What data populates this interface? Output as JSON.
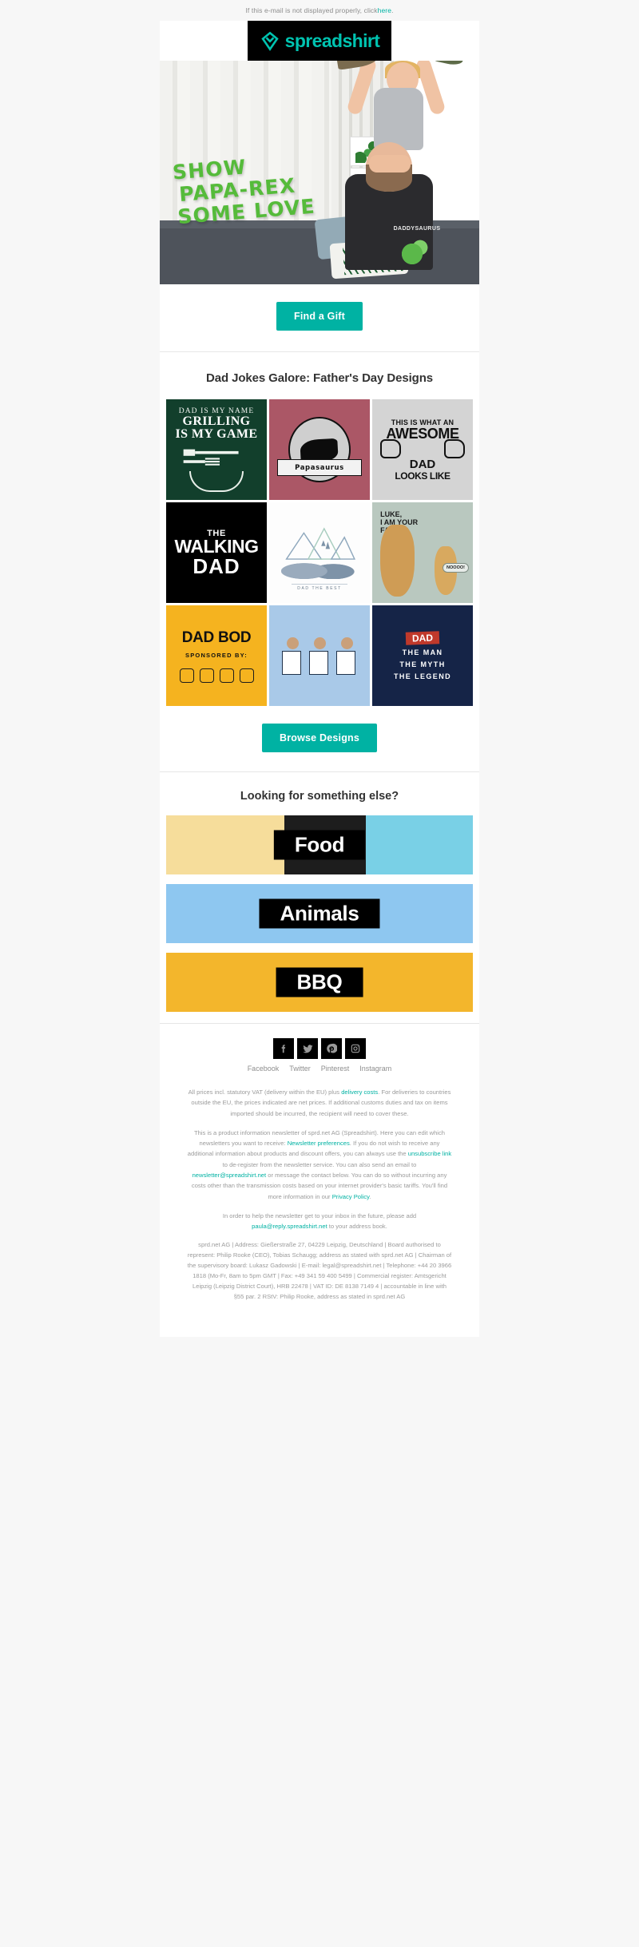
{
  "preheader": {
    "text_before": "If this e-mail is not displayed properly, click ",
    "link": "here",
    "text_after": "."
  },
  "brand": {
    "name": "spreadshirt",
    "logo_icon": "spreadshirt-heart-logo",
    "accent_color": "#00b2a3",
    "logo_bg": "#000000"
  },
  "hero": {
    "headline_line1": "SHOW",
    "headline_line2": "PAPA-REX",
    "headline_line3": "SOME LOVE",
    "headline_color": "#55bb3a",
    "shirt_text": "DADDYSAURUS",
    "alt": "Father holding son on shoulders with toy dinosaurs"
  },
  "cta": {
    "find_gift_label": "Find a Gift",
    "browse_label": "Browse Designs"
  },
  "designs_section": {
    "heading": "Dad Jokes Galore: Father's Day Designs",
    "tiles": [
      {
        "name": "grilling",
        "line1": "DAD IS MY NAME",
        "line2": "GRILLING",
        "line3": "IS MY GAME",
        "bg": "#123f2c"
      },
      {
        "name": "papasaurus",
        "label": "Papasaurus",
        "bg": "#ab5766"
      },
      {
        "name": "awesome-dad",
        "line1": "THIS IS WHAT AN",
        "line2": "AWESOME",
        "line3": "DAD",
        "line4": "LOOKS LIKE",
        "bg": "#d4d4d4"
      },
      {
        "name": "walking-dad",
        "line1": "THE",
        "line2": "WALKING",
        "line3": "DAD",
        "bg": "#000000"
      },
      {
        "name": "bears",
        "caption": "DAD THE BEST",
        "bg": "#fdfdfd"
      },
      {
        "name": "guitar-father",
        "line1": "LUKE,",
        "line2": "I AM YOUR",
        "line3": "FATHER",
        "bubble": "NOOOO!",
        "bg": "#b9c8bf"
      },
      {
        "name": "dad-bod",
        "line1": "DAD BOD",
        "line2": "SPONSORED BY:",
        "bg": "#f5b31f"
      },
      {
        "name": "dads-group",
        "bg": "#a9c9e8"
      },
      {
        "name": "man-myth-legend",
        "line0": "DAD",
        "line1": "THE MAN",
        "line2": "THE MYTH",
        "line3": "THE LEGEND",
        "bg": "#152447"
      }
    ]
  },
  "categories_section": {
    "heading": "Looking for something else?",
    "banners": [
      {
        "label": "Food",
        "bg": "#f6dd9b"
      },
      {
        "label": "Animals",
        "bg": "#8ec7f0"
      },
      {
        "label": "BBQ",
        "bg": "#f3b62c"
      }
    ]
  },
  "social": {
    "items": [
      {
        "name": "facebook",
        "label": "Facebook",
        "icon": "facebook-icon"
      },
      {
        "name": "twitter",
        "label": "Twitter",
        "icon": "twitter-icon"
      },
      {
        "name": "pinterest",
        "label": "Pinterest",
        "icon": "pinterest-icon"
      },
      {
        "name": "instagram",
        "label": "Instagram",
        "icon": "instagram-icon"
      }
    ]
  },
  "legal": {
    "vat_p1": "All prices incl. statutory VAT (delivery within the EU) plus ",
    "vat_link": "delivery costs",
    "vat_p2": ". For deliveries to countries outside the EU, the prices indicated are net prices. If additional customs duties and tax on items imported should be incurred, the recipient will need to cover these.",
    "news_p1": "This is a product information newsletter of sprd.net AG (Spreadshirt). Here you can edit which newsletters you want to receive: ",
    "news_link1": "Newsletter preferences",
    "news_p2": ". If you do not wish to receive any additional information about products and discount offers, you can always use the ",
    "news_link2": "unsubscribe link",
    "news_p3": " to de-register from the newsletter service. You can also send an email to ",
    "news_link3": "newsletter@spreadshirt.net",
    "news_p4": " or message the contact below. You can do so without incurring any costs other than the transmission costs based on your internet provider's basic tariffs. You'll find more information in our ",
    "news_link4": "Privacy Policy",
    "news_p5": ".",
    "inbox_p1": "In order to help the newsletter get to your inbox in the future, please add ",
    "inbox_link": "paula@reply.spreadshirt.net",
    "inbox_p2": " to your address book.",
    "address": "sprd.net AG | Address: Gießerstraße 27, 04229 Leipzig, Deutschland | Board authorised to represent: Philip Rooke (CEO), Tobias Schaugg; address as stated with sprd.net AG | Chairman of the supervisory board: Lukasz Gadowski | E-mail: legal@spreadshirt.net | Telephone: +44 20 3966 1818 (Mo-Fr, 8am to 5pm GMT | Fax: +49 341 59 400 5499 | Commercial register: Amtsgericht Leipzig (Leipzig District Court), HRB 22478 | VAT ID: DE 8138 7149 4 | accountable in line with §55 par. 2 RStV: Philip Rooke, address as stated in sprd.net AG"
  }
}
